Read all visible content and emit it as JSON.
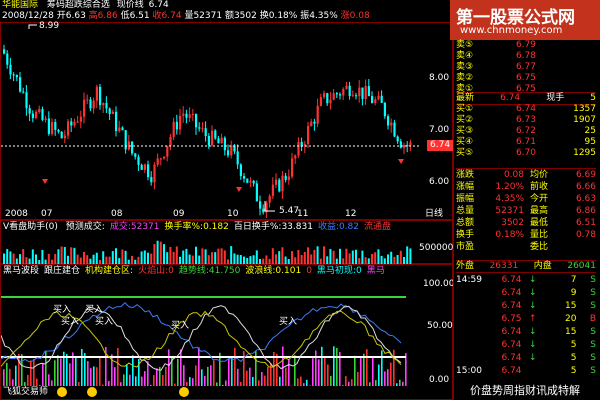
{
  "header": {
    "name": "华能国际",
    "indicator": "筹码超跌综合选",
    "price_label": "现价线",
    "price_value": "6.74"
  },
  "info_bar": {
    "date": "2008/12/28",
    "open": "开6.63",
    "high": "高6.86",
    "low": "低6.51",
    "close": "收6.74",
    "volume": "量52371",
    "amount": "额3502",
    "turnover": "换0.18%",
    "amplitude": "振4.35%",
    "change": "涨0.08"
  },
  "main_chart": {
    "y_ticks": [
      "8.00",
      "7.00",
      "6.00"
    ],
    "high_mark": "8.99",
    "low_mark": "5.47",
    "current_price_tag": "6.74",
    "x_ticks": [
      "2008",
      "07",
      "08",
      "09",
      "10",
      "11",
      "12"
    ],
    "day_line_label": "日线"
  },
  "volume_panel": {
    "label": "V看盘助手(0)",
    "items": [
      {
        "text": "预测成交:",
        "color": "#ffffff"
      },
      {
        "text": "成交:52371",
        "color": "#ff40ff"
      },
      {
        "text": "换手率%:0.182",
        "color": "#ffff00"
      },
      {
        "text": "百日换手%:33.831",
        "color": "#ffffff"
      },
      {
        "text": "收益:0.82",
        "color": "#3a7bff"
      },
      {
        "text": "流通盘",
        "color": "#ff3232"
      }
    ],
    "y_tick": "500000"
  },
  "indicator_panel": {
    "items": [
      {
        "text": "黑马波段",
        "color": "#ffffff"
      },
      {
        "text": "跟庄建仓",
        "color": "#ffffff"
      },
      {
        "text": "机构建仓区:",
        "color": "#ffff00"
      },
      {
        "text": "火焰山:0",
        "color": "#ff3232"
      },
      {
        "text": "趋势线:41.750",
        "color": "#3ad53a"
      },
      {
        "text": "波浪线:0.101",
        "color": "#ffff00"
      },
      {
        "text": "0",
        "color": "#ff3232"
      },
      {
        "text": "黑马初现:0",
        "color": "#00ffff"
      },
      {
        "text": "黑马",
        "color": "#ff40ff"
      }
    ],
    "y_ticks": [
      "100.00",
      "50.00",
      "0.00"
    ],
    "buy_labels": [
      "买入",
      "买入",
      "买入",
      "买入",
      "买入",
      "买入"
    ],
    "footer_text": "飞狐交易师"
  },
  "watermark": {
    "title": "第一股票公式网",
    "url": "www.chnmoney.com"
  },
  "quote": {
    "sells": [
      {
        "label": "卖⑤",
        "price": "6.79",
        "vol": "",
        "show_vol": false
      },
      {
        "label": "卖④",
        "price": "6.78",
        "vol": "",
        "show_vol": false
      },
      {
        "label": "卖③",
        "price": "6.77",
        "vol": "",
        "show_vol": false
      },
      {
        "label": "卖②",
        "price": "6.75",
        "vol": "",
        "show_vol": false
      },
      {
        "label": "卖①",
        "price": "6.75",
        "vol": "",
        "show_vol": false
      }
    ],
    "latest_label": "最新",
    "latest_price": "6.74",
    "latest_hand_label": "现手",
    "latest_hand": "5",
    "buys": [
      {
        "label": "买①",
        "price": "6.74",
        "vol": "1357"
      },
      {
        "label": "买②",
        "price": "6.73",
        "vol": "1907"
      },
      {
        "label": "买③",
        "price": "6.72",
        "vol": "25"
      },
      {
        "label": "买④",
        "price": "6.71",
        "vol": "95"
      },
      {
        "label": "买⑤",
        "price": "6.70",
        "vol": "1295"
      }
    ],
    "stats": [
      {
        "k1": "涨跌",
        "v1": "0.08",
        "k2": "均价",
        "v2": "6.69"
      },
      {
        "k1": "涨幅",
        "v1": "1.20%",
        "k2": "前收",
        "v2": "6.66"
      },
      {
        "k1": "振幅",
        "v1": "4.35%",
        "k2": "今开",
        "v2": "6.63"
      },
      {
        "k1": "总量",
        "v1": "52371",
        "k2": "最高",
        "v2": "6.86"
      },
      {
        "k1": "总额",
        "v1": "3502",
        "k2": "最低",
        "v2": "6.51"
      },
      {
        "k1": "换手",
        "v1": "0.18%",
        "k2": "量比",
        "v2": "0.78"
      },
      {
        "k1": "市盈",
        "v1": "",
        "k2": "委比",
        "v2": ""
      }
    ],
    "outer_label": "外盘",
    "outer_value": "26331",
    "inner_label": "内盘",
    "inner_value": "26041",
    "ticks": [
      {
        "time": "14:59",
        "price": "6.74",
        "dir": "↓",
        "vol": "7",
        "side": "S"
      },
      {
        "time": "",
        "price": "6.74",
        "dir": "↓",
        "vol": "9",
        "side": "S"
      },
      {
        "time": "",
        "price": "6.74",
        "dir": "↓",
        "vol": "15",
        "side": "S"
      },
      {
        "time": "",
        "price": "6.75",
        "dir": "↑",
        "vol": "20",
        "side": "B"
      },
      {
        "time": "",
        "price": "6.74",
        "dir": "↓",
        "vol": "15",
        "side": "S"
      },
      {
        "time": "",
        "price": "6.74",
        "dir": "↓",
        "vol": "5",
        "side": "S"
      },
      {
        "time": "",
        "price": "6.74",
        "dir": "↓",
        "vol": "5",
        "side": "S"
      },
      {
        "time": "15:00",
        "price": "6.74",
        "dir": "",
        "vol": "5",
        "side": "S"
      }
    ]
  },
  "bottom_slogan": "价盘势周指财讯成特解",
  "colors": {
    "up": "#ff3232",
    "down": "#00ffff",
    "ma_white": "#ffffff",
    "ma_yellow": "#ffff00",
    "ma_green": "#3ad53a",
    "ma_magenta": "#ff40ff",
    "panel_border": "#800000"
  }
}
